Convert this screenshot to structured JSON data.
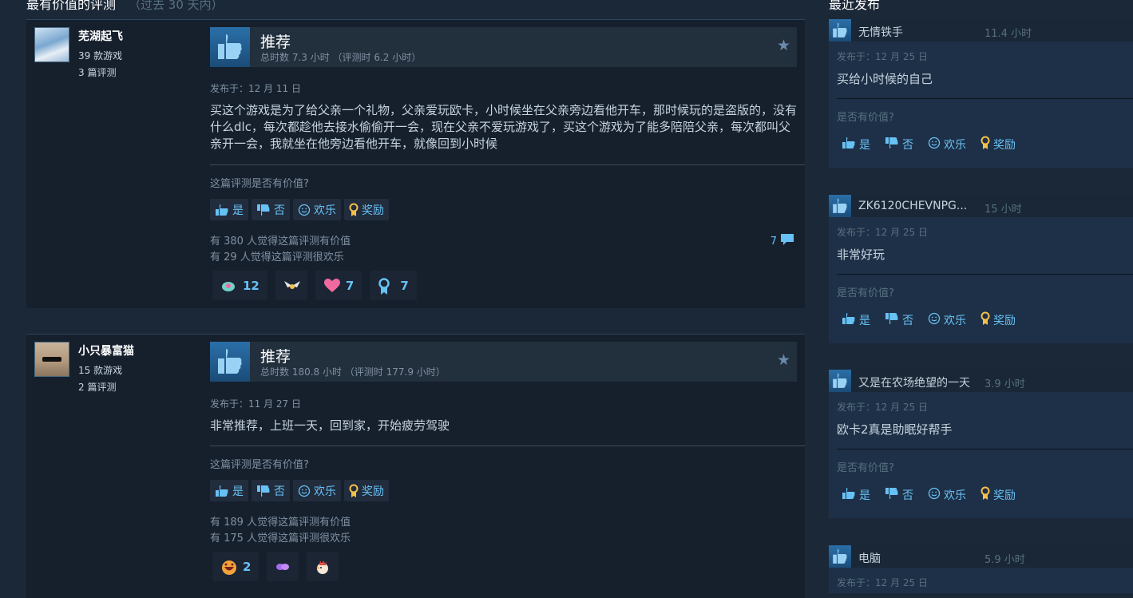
{
  "left_section": {
    "title": "最有价值的评测",
    "subtitle": "（过去 30 天内）"
  },
  "right_section": {
    "title": "最近发布"
  },
  "reviews": [
    {
      "author": "芜湖起飞",
      "games": "39 款游戏",
      "reviews_count": "3 篇评测",
      "verdict": "推荐",
      "hours": "总时数 7.3 小时 （评测时 6.2 小时）",
      "posted": "发布于：12 月 11 日",
      "content": "买这个游戏是为了给父亲一个礼物，父亲爱玩欧卡，小时候坐在父亲旁边看他开车，那时候玩的是盗版的，没有什么dlc，每次都趁他去接水偷偷开一会，现在父亲不爱玩游戏了，买这个游戏为了能多陪陪父亲，每次都叫父亲开一会，我就坐在他旁边看他开车，就像回到小时候",
      "helpful_question": "这篇评测是否有价值?",
      "btn_yes": "是",
      "btn_no": "否",
      "btn_funny": "欢乐",
      "btn_award": "奖励",
      "helpful_count": "有 380 人觉得这篇评测有价值",
      "funny_count": "有 29 人觉得这篇评测很欢乐",
      "comment_count": "7",
      "awards": [
        {
          "icon": "award-gem-icon",
          "count": "12",
          "color": "#6fd3c8"
        },
        {
          "icon": "award-wings-icon",
          "count": "",
          "color": "#e6e6e6"
        },
        {
          "icon": "award-heart-icon",
          "count": "7",
          "color": "#f06aa0"
        },
        {
          "icon": "award-ribbon-icon",
          "count": "7",
          "color": "#67c1f5"
        }
      ]
    },
    {
      "author": "小只暴富猫",
      "games": "15 款游戏",
      "reviews_count": "2 篇评测",
      "verdict": "推荐",
      "hours": "总时数 180.8 小时 （评测时 177.9 小时）",
      "posted": "发布于：11 月 27 日",
      "content": "非常推荐，上班一天，回到家，开始疲劳驾驶",
      "helpful_question": "这篇评测是否有价值?",
      "btn_yes": "是",
      "btn_no": "否",
      "btn_funny": "欢乐",
      "btn_award": "奖励",
      "helpful_count": "有 189 人觉得这篇评测有价值",
      "funny_count": "有 175 人觉得这篇评测很欢乐",
      "awards": [
        {
          "icon": "award-laugh-icon",
          "count": "2",
          "color": "#f2a33a"
        },
        {
          "icon": "award-purple-icon",
          "count": "",
          "color": "#a46cf0"
        },
        {
          "icon": "award-rooster-icon",
          "count": "",
          "color": "#e14b3b"
        }
      ]
    }
  ],
  "recent": [
    {
      "name": "无情铁手",
      "hours": "11.4 小时",
      "posted": "发布于：12 月 25 日",
      "text": "买给小时候的自己",
      "question": "是否有价值?",
      "yes": "是",
      "no": "否",
      "funny": "欢乐",
      "award": "奖励"
    },
    {
      "name": "ZK6120CHEVNPG...",
      "hours": "15 小时",
      "posted": "发布于：12 月 25 日",
      "text": "非常好玩",
      "question": "是否有价值?",
      "yes": "是",
      "no": "否",
      "funny": "欢乐",
      "award": "奖励"
    },
    {
      "name": "又是在农场绝望的一天",
      "hours": "3.9 小时",
      "posted": "发布于：12 月 25 日",
      "text": "欧卡2真是助眠好帮手",
      "question": "是否有价值?",
      "yes": "是",
      "no": "否",
      "funny": "欢乐",
      "award": "奖励"
    },
    {
      "name": "电脑",
      "hours": "5.9 小时",
      "posted": "发布于：12 月 25 日"
    }
  ]
}
